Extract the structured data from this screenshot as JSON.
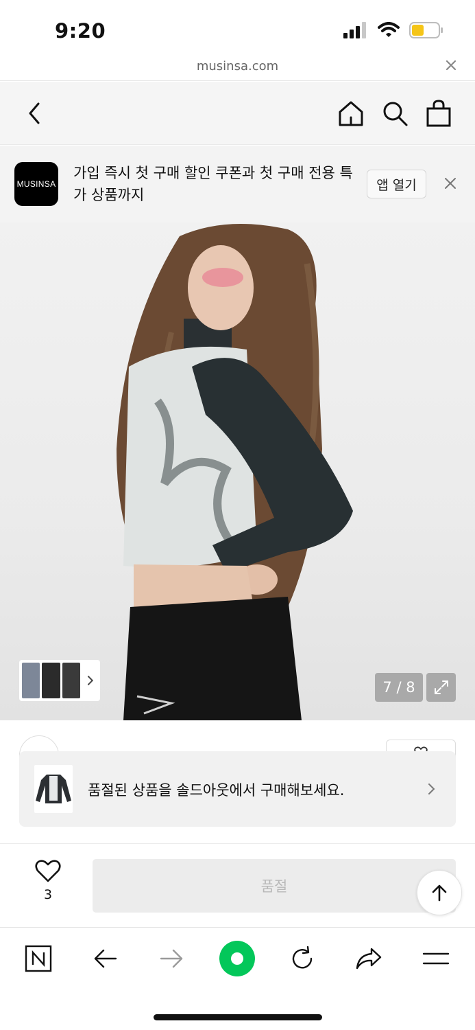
{
  "status_bar": {
    "time": "9:20",
    "icons": [
      "signal-icon",
      "wifi-icon",
      "battery-icon"
    ],
    "battery_color": "#f5c518"
  },
  "url_bar": {
    "url": "musinsa.com",
    "close_icon": "close-icon"
  },
  "nav": {
    "icons": [
      "back-icon",
      "home-icon",
      "search-icon",
      "cart-icon"
    ]
  },
  "banner": {
    "logo_text": "MUSINSA",
    "message": "가입 즉시 첫 구매 할인 쿠폰과 첫 구매 전용 특가 상품까지",
    "open_app_label": "앱 열기"
  },
  "product_gallery": {
    "counter": "7 / 8",
    "expand_icon": "expand-icon",
    "thumbnail_more_icon": "chevron-right-icon"
  },
  "soldout_notice": {
    "message": "품절된 상품을 솔드아웃에서 구매해보세요.",
    "chevron_icon": "chevron-right-icon"
  },
  "buy_bar": {
    "wishlist_count": "3",
    "soldout_label": "품절",
    "scroll_top_icon": "arrow-up-icon"
  },
  "browser_toolbar": {
    "items": [
      "naver-home-icon",
      "back-arrow-icon",
      "forward-arrow-icon",
      "green-dot-icon",
      "reload-icon",
      "share-icon",
      "menu-icon"
    ],
    "accent_color": "#03c75a"
  }
}
